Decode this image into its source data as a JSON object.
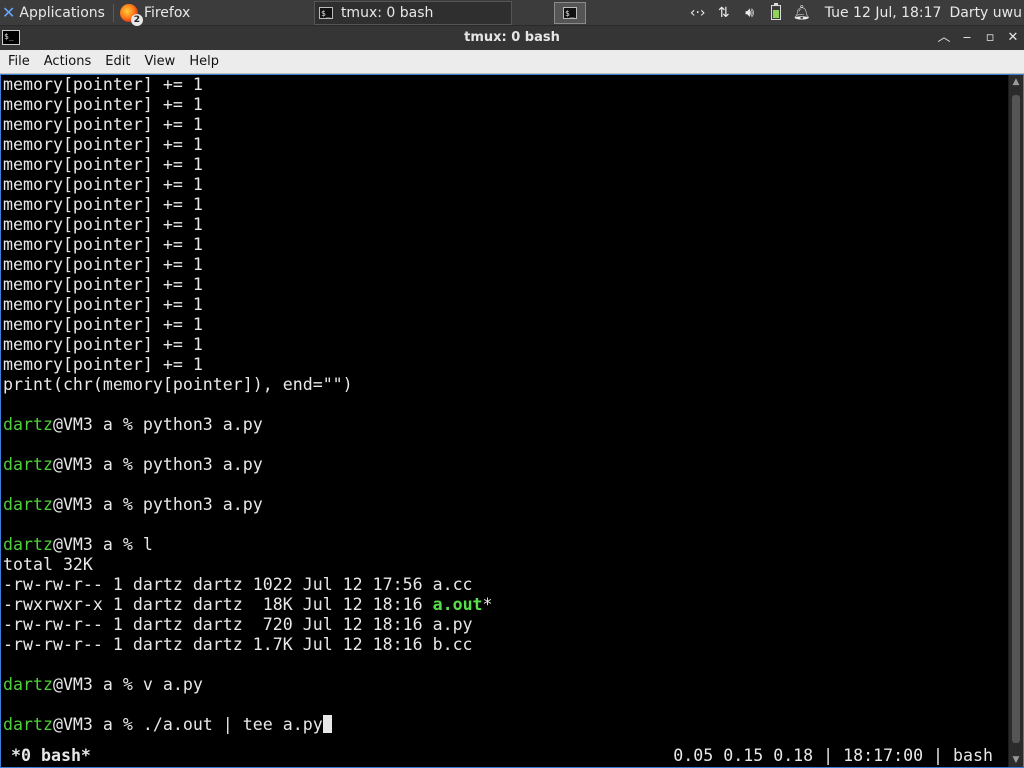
{
  "panel": {
    "applications_label": "Applications",
    "tasks": [
      {
        "label": "Firefox",
        "badge": "2",
        "icon": "firefox-icon"
      },
      {
        "label": "tmux: 0 bash",
        "icon": "terminal-icon"
      }
    ],
    "tray_icons": [
      "network-transfer-icon",
      "network-icon",
      "volume-icon",
      "battery-icon",
      "notification-bell-icon"
    ],
    "clock": "Tue 12 Jul, 18:17",
    "user": "Darty uwu"
  },
  "window": {
    "title": "tmux: 0 bash",
    "controls": [
      "restore-icon",
      "minimize-icon",
      "maximize-icon",
      "close-icon"
    ]
  },
  "menu": [
    "File",
    "Actions",
    "Edit",
    "View",
    "Help"
  ],
  "terminal": {
    "lines": [
      "memory[pointer] += 1",
      "memory[pointer] += 1",
      "memory[pointer] += 1",
      "memory[pointer] += 1",
      "memory[pointer] += 1",
      "memory[pointer] += 1",
      "memory[pointer] += 1",
      "memory[pointer] += 1",
      "memory[pointer] += 1",
      "memory[pointer] += 1",
      "memory[pointer] += 1",
      "memory[pointer] += 1",
      "memory[pointer] += 1",
      "memory[pointer] += 1",
      "memory[pointer] += 1",
      "print(chr(memory[pointer]), end=\"\")",
      "",
      {
        "user": "dartz",
        "rest": "@VM3 a % python3 a.py"
      },
      "",
      {
        "user": "dartz",
        "rest": "@VM3 a % python3 a.py"
      },
      "",
      {
        "user": "dartz",
        "rest": "@VM3 a % python3 a.py"
      },
      "",
      {
        "user": "dartz",
        "rest": "@VM3 a % l"
      },
      "total 32K",
      "-rw-rw-r-- 1 dartz dartz 1022 Jul 12 17:56 a.cc",
      {
        "pre": "-rwxrwxr-x 1 dartz dartz  18K Jul 12 18:16 ",
        "exe": "a.out",
        "post": "*"
      },
      "-rw-rw-r-- 1 dartz dartz  720 Jul 12 18:16 a.py",
      "-rw-rw-r-- 1 dartz dartz 1.7K Jul 12 18:16 b.cc",
      "",
      {
        "user": "dartz",
        "rest": "@VM3 a % v a.py"
      },
      "",
      {
        "user": "dartz",
        "rest": "@VM3 a % ./a.out | tee a.py",
        "cursor": true
      }
    ]
  },
  "tmux_status": {
    "left": "*0 bash*",
    "right": "0.05 0.15 0.18 | 18:17:00 | bash"
  },
  "colors": {
    "prompt_user": "#4fcf3a",
    "executable": "#56e04a",
    "window_border": "#3d7fd6"
  }
}
